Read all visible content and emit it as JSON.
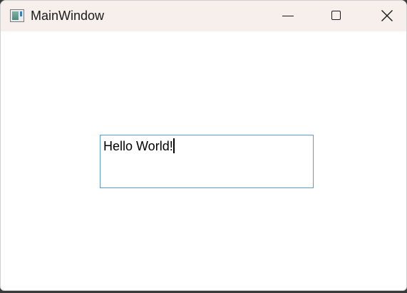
{
  "window": {
    "title": "MainWindow"
  },
  "caption_buttons": {
    "minimize_icon": "minimize-icon",
    "maximize_icon": "maximize-icon",
    "close_icon": "close-icon"
  },
  "textbox": {
    "value": "Hello World!"
  },
  "colors": {
    "titlebar_bg": "#f6efeb",
    "textbox_border": "#5b9bd5"
  }
}
